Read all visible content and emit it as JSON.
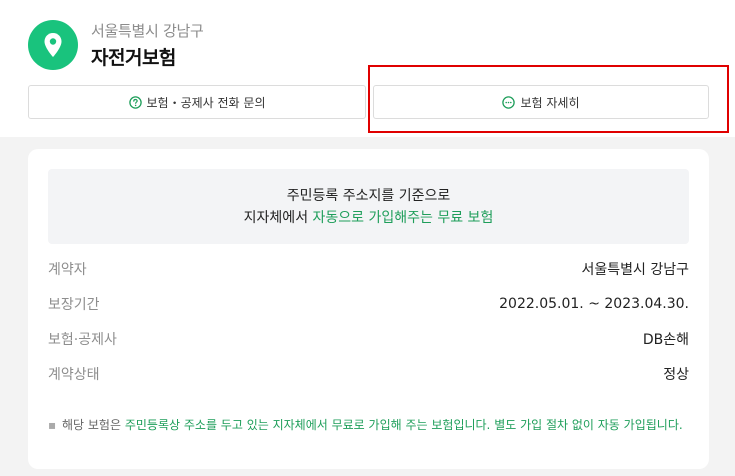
{
  "header": {
    "subtitle": "서울특별시 강남구",
    "title": "자전거보험",
    "icon": "location-pin-icon",
    "accent_color": "#19c37d"
  },
  "buttons": {
    "call_label": "보험・공제사 전화 문의",
    "call_icon": "question-circle-icon",
    "detail_label": "보험 자세히",
    "detail_icon": "more-circle-icon"
  },
  "notice": {
    "line1": "주민등록 주소지를 기준으로",
    "line2_prefix": "지자체에서 ",
    "line2_green": "자동으로 가입해주는 무료 보험",
    "green_color": "#1e9e5a"
  },
  "details": [
    {
      "label": "계약자",
      "value": "서울특별시 강남구"
    },
    {
      "label": "보장기간",
      "value": "2022.05.01. ~ 2023.04.30."
    },
    {
      "label": "보험·공제사",
      "value": "DB손해"
    },
    {
      "label": "계약상태",
      "value": "정상"
    }
  ],
  "footnote": {
    "prefix": "해당 보험은 ",
    "green": "주민등록상 주소를 두고 있는 지자체에서 무료로 가입해 주는 보험입니다. 별도 가입 절차 없이 자동 가입됩니다.",
    "bullet": "▪"
  },
  "highlight_color": "#e00000"
}
